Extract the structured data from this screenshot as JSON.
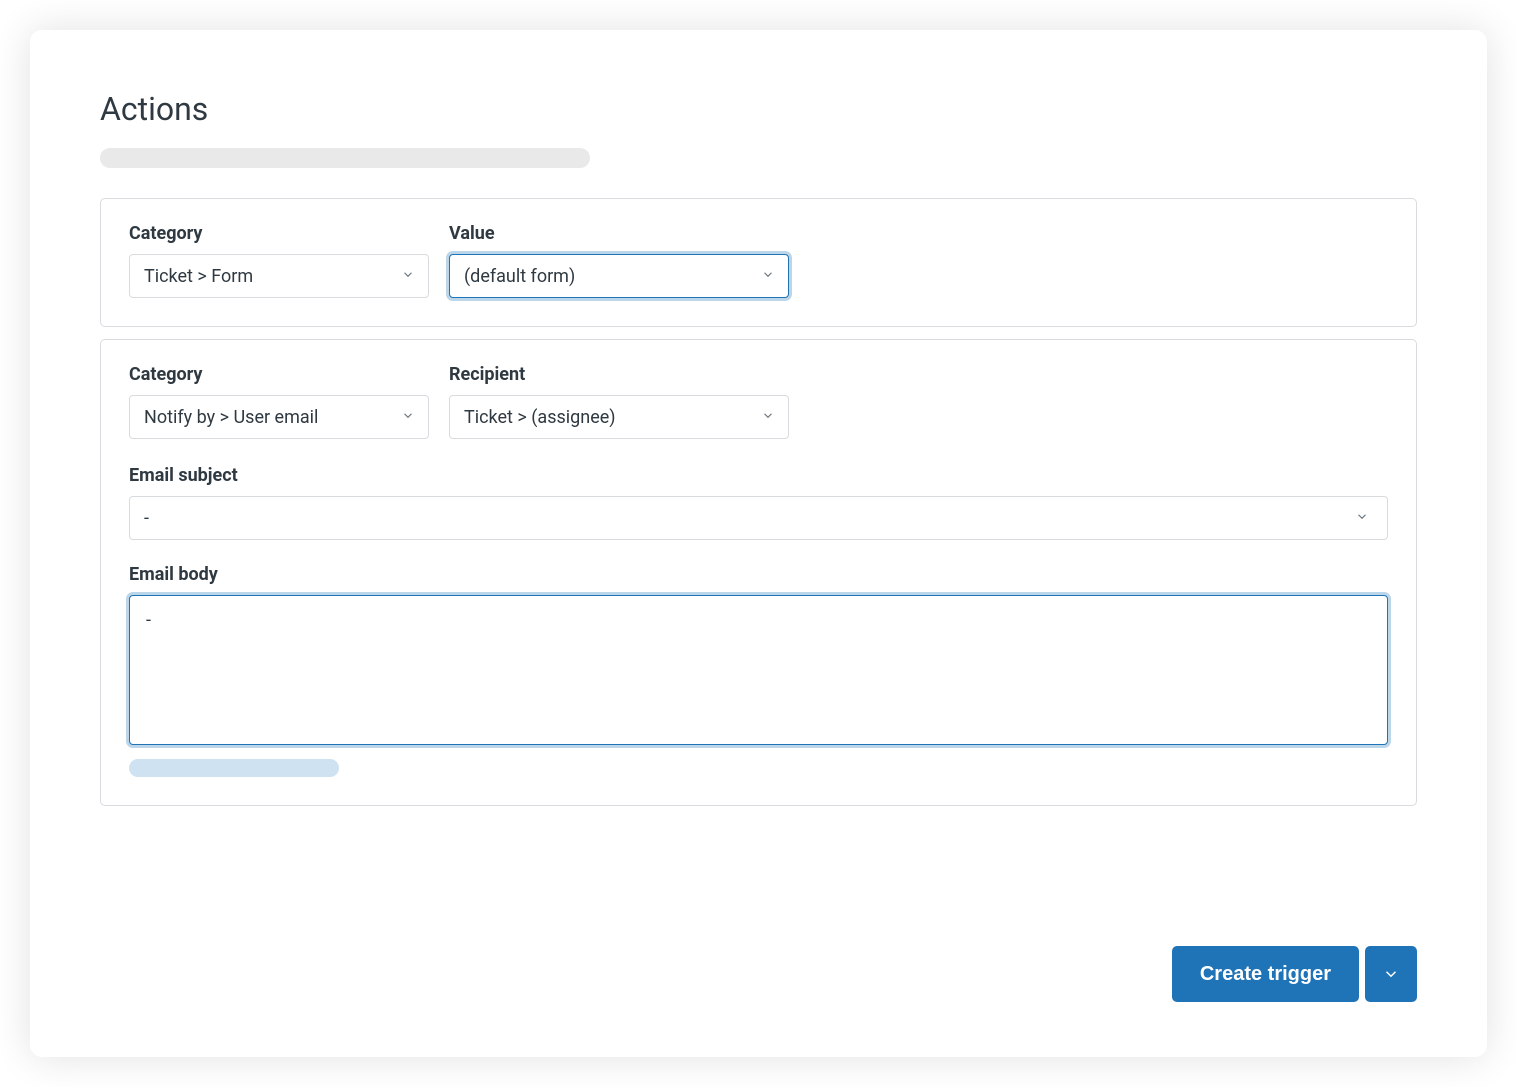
{
  "section": {
    "title": "Actions"
  },
  "actions": [
    {
      "category_label": "Category",
      "category_value": "Ticket > Form",
      "value_label": "Value",
      "value_value": "(default form)"
    },
    {
      "category_label": "Category",
      "category_value": "Notify by > User email",
      "recipient_label": "Recipient",
      "recipient_value": "Ticket > (assignee)",
      "email_subject_label": "Email subject",
      "email_subject_value": "-",
      "email_body_label": "Email body",
      "email_body_value": "-"
    }
  ],
  "footer": {
    "create_trigger_label": "Create trigger"
  }
}
